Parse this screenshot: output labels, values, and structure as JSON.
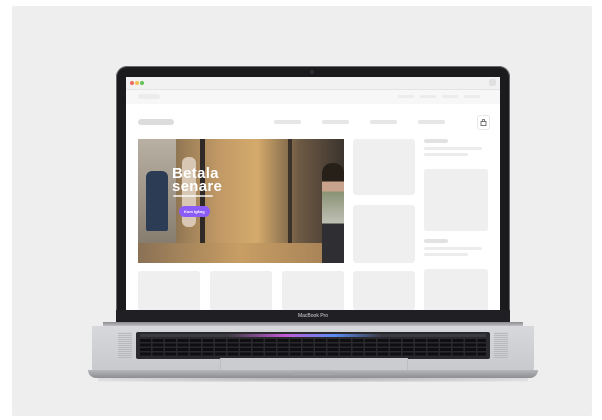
{
  "hero": {
    "title": "Betala\nsenare",
    "button_label": "Kom Igång"
  },
  "laptop": {
    "brand": "MacBook Pro"
  },
  "icons": {
    "cart": "shopping-bag-icon",
    "window_controls": [
      "close-dot-icon",
      "minimize-dot-icon",
      "maximize-dot-icon"
    ]
  },
  "colors": {
    "background": "#eeeeee",
    "hero_button": "#8b5cf6",
    "placeholder": "#efefef"
  }
}
